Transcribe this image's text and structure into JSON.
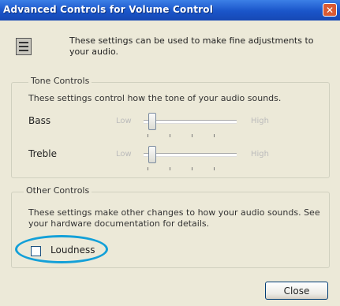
{
  "window": {
    "title": "Advanced Controls for Volume Control",
    "close_glyph": "✕"
  },
  "intro": {
    "icon": "mixer-settings-icon",
    "text": "These settings can be used to make fine adjustments to your audio."
  },
  "tone_controls": {
    "legend": "Tone Controls",
    "description": "These settings control how the tone of your audio sounds.",
    "bass": {
      "label": "Bass",
      "min_label": "Low",
      "max_label": "High",
      "level": 0.06
    },
    "treble": {
      "label": "Treble",
      "min_label": "Low",
      "max_label": "High",
      "level": 0.06
    }
  },
  "other_controls": {
    "legend": "Other Controls",
    "description": "These settings make other changes to how your audio sounds. See your hardware documentation for details.",
    "loudness": {
      "label": "Loudness",
      "checked": false
    }
  },
  "buttons": {
    "close_label": "Close"
  },
  "colors": {
    "titlebar": "#1a55c9",
    "highlight_circle": "#13a0d8",
    "dialog_bg": "#ece9d8"
  }
}
